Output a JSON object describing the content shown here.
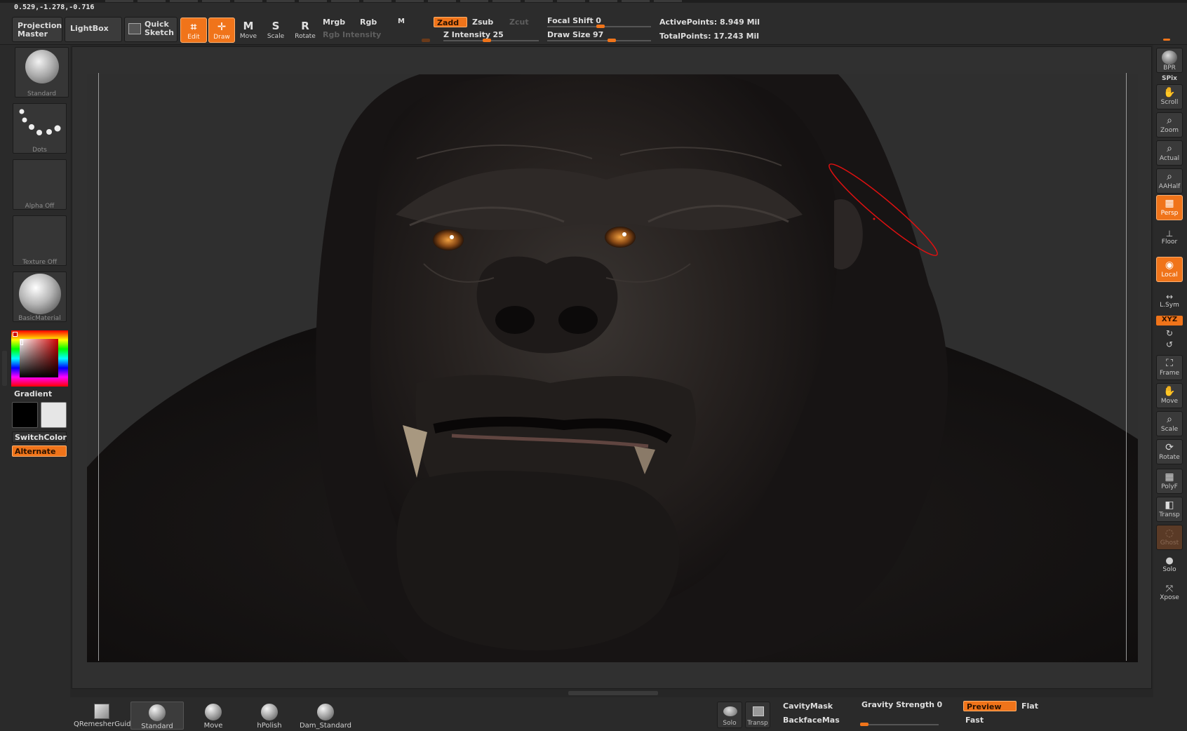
{
  "readout": {
    "coordinates": "0.529,-1.278,-0.716"
  },
  "toolbar": {
    "projection_master": "Projection Master",
    "lightbox": "LightBox",
    "quick_sketch": "Quick Sketch",
    "tools": [
      {
        "label": "Edit",
        "active": true
      },
      {
        "label": "Draw",
        "active": true
      },
      {
        "label": "Move",
        "active": false
      },
      {
        "label": "Scale",
        "active": false
      },
      {
        "label": "Rotate",
        "active": false
      }
    ],
    "mrgb": "Mrgb",
    "rgb": "Rgb",
    "m": "M",
    "zadd": "Zadd",
    "zsub": "Zsub",
    "zcut": "Zcut",
    "rgb_intensity": "Rgb Intensity",
    "z_intensity_label": "Z Intensity",
    "z_intensity": 25,
    "focal_shift_label": "Focal Shift",
    "focal_shift": 0,
    "draw_size_label": "Draw Size",
    "draw_size": 97,
    "active_points": "ActivePoints: 8.949 Mil",
    "total_points": "TotalPoints: 17.243 Mil"
  },
  "left_shelf": {
    "brush": "Standard",
    "stroke": "Dots",
    "alpha": "Alpha Off",
    "texture": "Texture Off",
    "material": "BasicMaterial",
    "gradient": "Gradient",
    "switch_color": "SwitchColor",
    "alternate": "Alternate",
    "main_color": "#000000",
    "secondary_color": "#e6e6e6"
  },
  "right_shelf": {
    "bpr": "BPR",
    "spix": "SPix",
    "items": [
      "Scroll",
      "Zoom",
      "Actual",
      "AAHalf",
      "Persp",
      "Floor",
      "Local",
      "L.Sym",
      "Frame",
      "Move",
      "Scale",
      "Rotate",
      "PolyF",
      "Transp",
      "Ghost",
      "Solo",
      "Xpose"
    ],
    "xyz": "XYZ"
  },
  "bottom_shelf": {
    "brushes": [
      "QRemesherGuide",
      "Standard",
      "Move",
      "hPolish",
      "Dam_Standard"
    ],
    "solo": "Solo",
    "transp": "Transp",
    "cavity_mask": "CavityMask",
    "backface_mask": "BackfaceMas",
    "gravity_label": "Gravity Strength",
    "gravity": 0,
    "preview": "Preview",
    "flat": "Flat",
    "fast": "Fast"
  },
  "colors": {
    "accent": "#f0741a",
    "panel": "#2a2a2a",
    "canvas": "#303030"
  }
}
